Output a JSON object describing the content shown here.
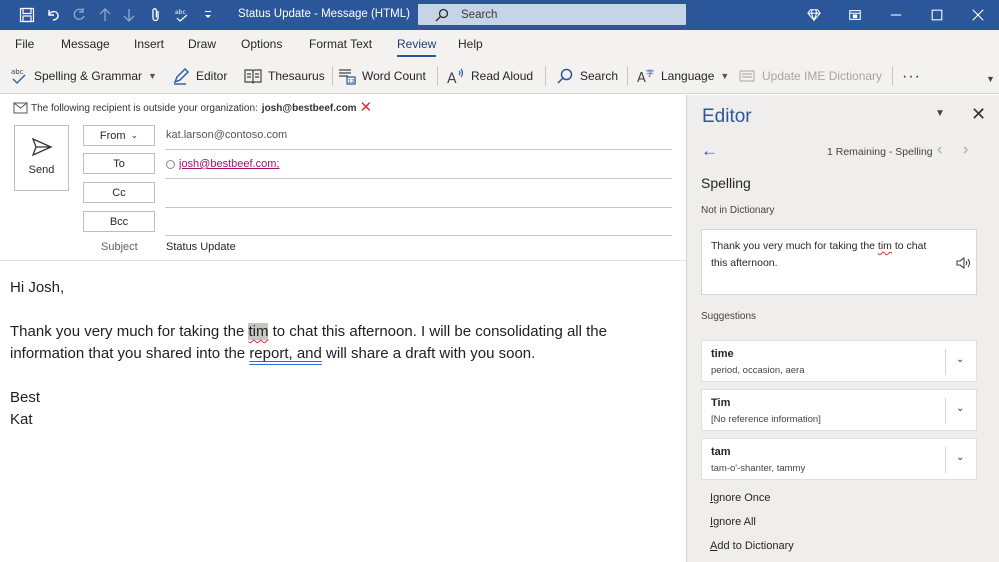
{
  "window": {
    "title": "Status Update  -  Message (HTML)",
    "search_placeholder": "Search"
  },
  "menu": [
    "File",
    "Message",
    "Insert",
    "Draw",
    "Options",
    "Format Text",
    "Review",
    "Help"
  ],
  "menu_active": "Review",
  "ribbon": {
    "spelling": "Spelling & Grammar",
    "editor": "Editor",
    "thesaurus": "Thesaurus",
    "word_count": "Word Count",
    "read_aloud": "Read Aloud",
    "search": "Search",
    "language": "Language",
    "ime": "Update IME Dictionary",
    "more": "···"
  },
  "compose": {
    "info_text": "The following recipient is outside your organization:",
    "info_email": "josh@bestbeef.com",
    "send": "Send",
    "from_label": "From",
    "from_value": "kat.larson@contoso.com",
    "to_label": "To",
    "to_value": "josh@bestbeef.com;",
    "cc_label": "Cc",
    "bcc_label": "Bcc",
    "subject_label": "Subject",
    "subject_value": "Status Update",
    "body": {
      "greeting": "Hi Josh,",
      "line1_a": "Thank you very much for taking the ",
      "line1_err": "tim",
      "line1_b": " to chat this afternoon. I will be consolidating all the",
      "line2_a": "information that you shared into the ",
      "line2_gram": "report, and",
      "line2_b": " will share a draft with you soon.",
      "closing": "Best",
      "name": "Kat"
    }
  },
  "editor": {
    "title": "Editor",
    "remaining": "1 Remaining - Spelling",
    "heading": "Spelling",
    "not_in_dict": "Not in Dictionary",
    "sentence_a": "Thank you very much for taking the ",
    "sentence_err": "tim",
    "sentence_b": " to chat this afternoon.",
    "suggestions_label": "Suggestions",
    "suggestions": [
      {
        "word": "time",
        "detail": "period, occasion, aera"
      },
      {
        "word": "Tim",
        "detail": "[No reference information]"
      },
      {
        "word": "tam",
        "detail": "tam-o'-shanter, tammy"
      }
    ],
    "ignore_once": "Ignore Once",
    "ignore_all": "Ignore All",
    "add_dict": "Add to Dictionary"
  },
  "colors": {
    "title_bar": "#2b579a",
    "accent": "#2b579a",
    "error_underline": "#d13438",
    "grammar_underline": "#2b6cd4",
    "link": "#a4126c"
  }
}
